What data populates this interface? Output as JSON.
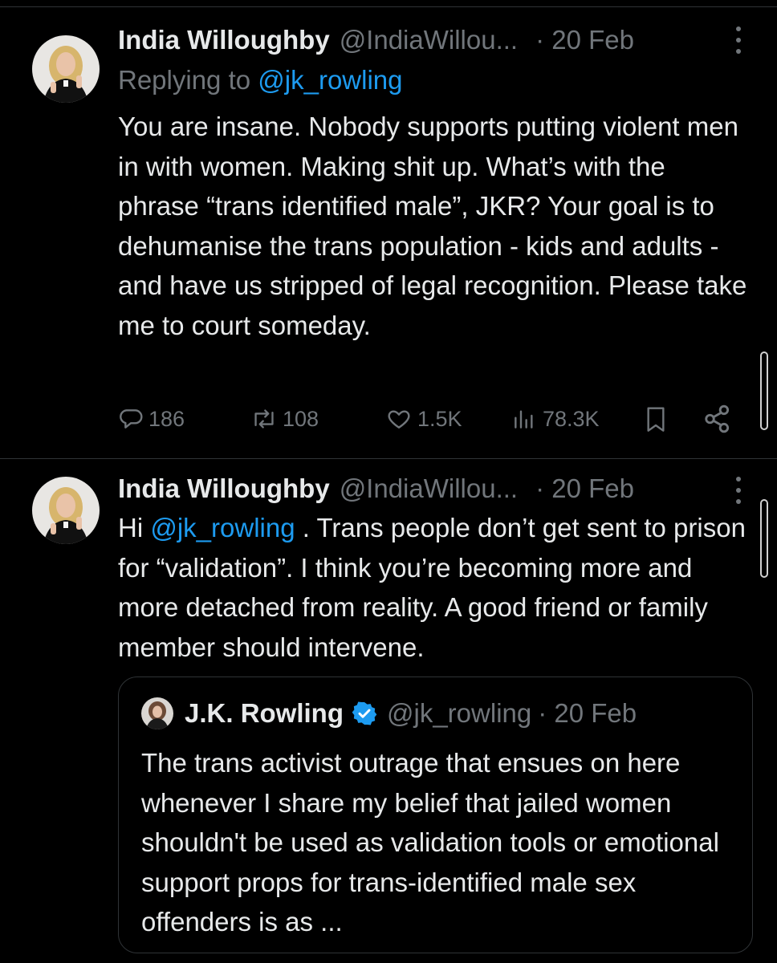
{
  "tweet1": {
    "display_name": "India Willoughby",
    "handle": "@IndiaWillou...",
    "date": "· 20 Feb",
    "reply_prefix": "Replying to ",
    "reply_to": "@jk_rowling",
    "text": "You are insane. Nobody supports putting violent men in with women. Making shit up. What’s with the phrase “trans identified male”, JKR? Your goal is to dehumanise the trans population - kids and adults - and have us stripped of legal recognition. Please take me to court someday.",
    "actions": {
      "replies": "186",
      "reposts": "108",
      "likes": "1.5K",
      "views": "78.3K"
    }
  },
  "tweet2": {
    "display_name": "India Willoughby",
    "handle": "@IndiaWillou...",
    "date": "· 20 Feb",
    "text_prefix": "Hi ",
    "mention": "@jk_rowling",
    "text_rest": " . Trans people don’t get sent to prison for “validation”. I think you’re becoming more and more detached from reality. A good friend or family member should intervene.",
    "quote": {
      "display_name": "J.K. Rowling",
      "handle": "@jk_rowling",
      "date": "· 20 Feb",
      "text": "The trans activist outrage that ensues on here whenever I share my belief that jailed women shouldn't be used as validation tools or emotional support props for trans-identified male sex offenders is as ..."
    }
  },
  "icons": {
    "reply": "reply-bubble-icon",
    "repost": "repost-icon",
    "like": "heart-icon",
    "views": "analytics-bars-icon",
    "bookmark": "bookmark-icon",
    "share": "share-icon",
    "more": "more-vertical-icon",
    "verified": "verified-badge-icon"
  },
  "colors": {
    "background": "#000000",
    "text": "#e7e9ea",
    "muted": "#71767b",
    "link": "#1d9bf0",
    "border": "#2f3336"
  }
}
